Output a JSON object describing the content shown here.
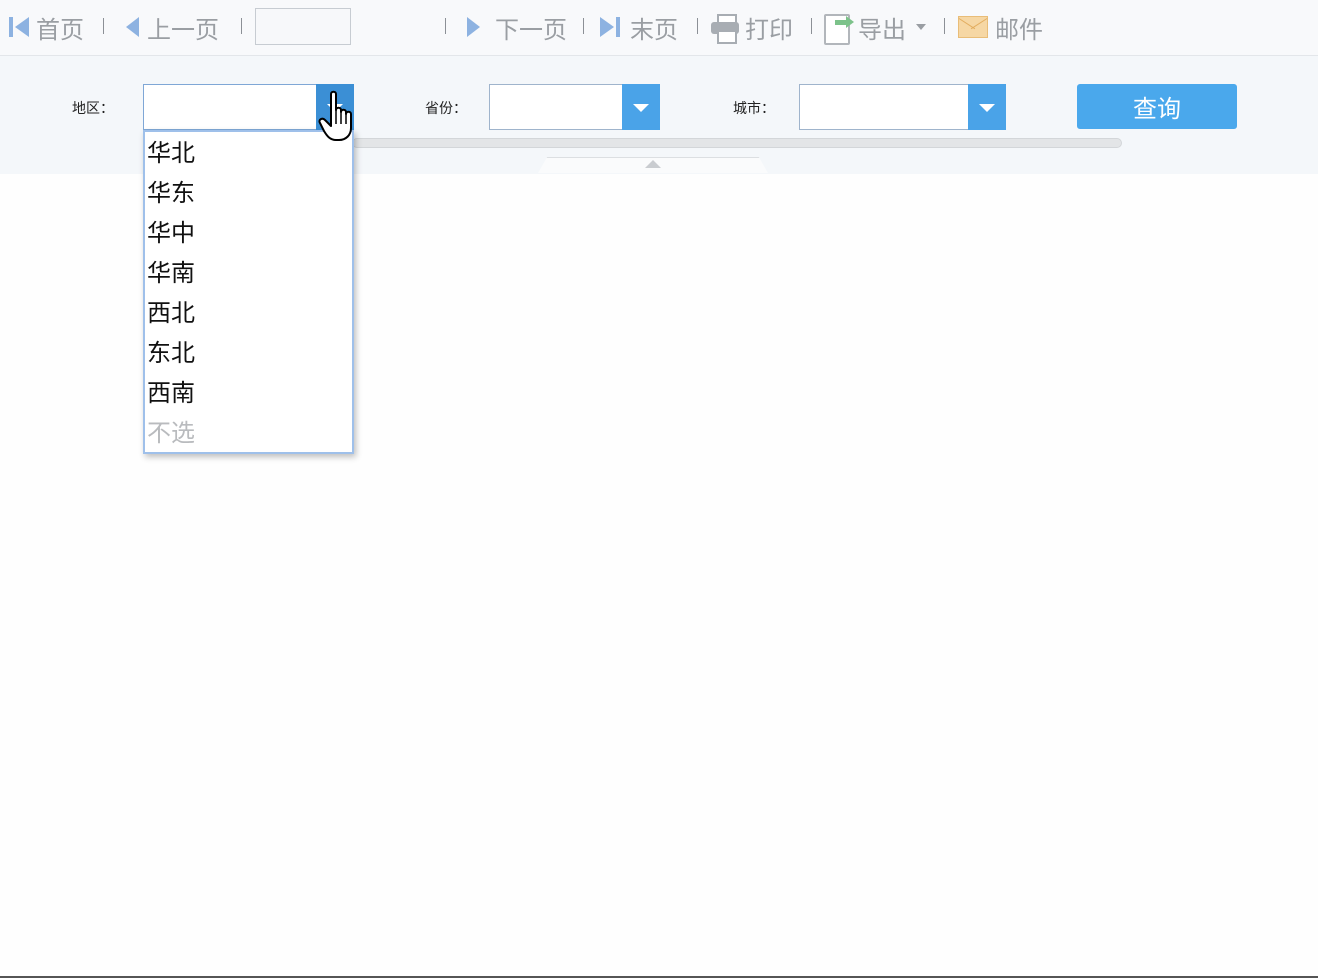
{
  "toolbar": {
    "first_page": "首页",
    "prev_page": "上一页",
    "page_input_value": "",
    "next_page": "下一页",
    "last_page": "末页",
    "print": "打印",
    "export": "导出",
    "mail": "邮件"
  },
  "params": {
    "region": {
      "label": "地区：",
      "value": ""
    },
    "province": {
      "label": "省份：",
      "value": ""
    },
    "city": {
      "label": "城市：",
      "value": ""
    },
    "query_button": "查询"
  },
  "dropdown": {
    "items": [
      "华北",
      "华东",
      "华中",
      "华南",
      "西北",
      "东北",
      "西南",
      "不选"
    ]
  },
  "colors": {
    "accent": "#4aa8ec",
    "toolbar_icon": "#8db2e1",
    "muted_text": "#b9bbbe"
  },
  "icons": [
    "first-page-icon",
    "prev-page-icon",
    "next-page-icon",
    "last-page-icon",
    "print-icon",
    "export-icon",
    "mail-icon",
    "chevron-down-icon",
    "hand-cursor-icon"
  ]
}
